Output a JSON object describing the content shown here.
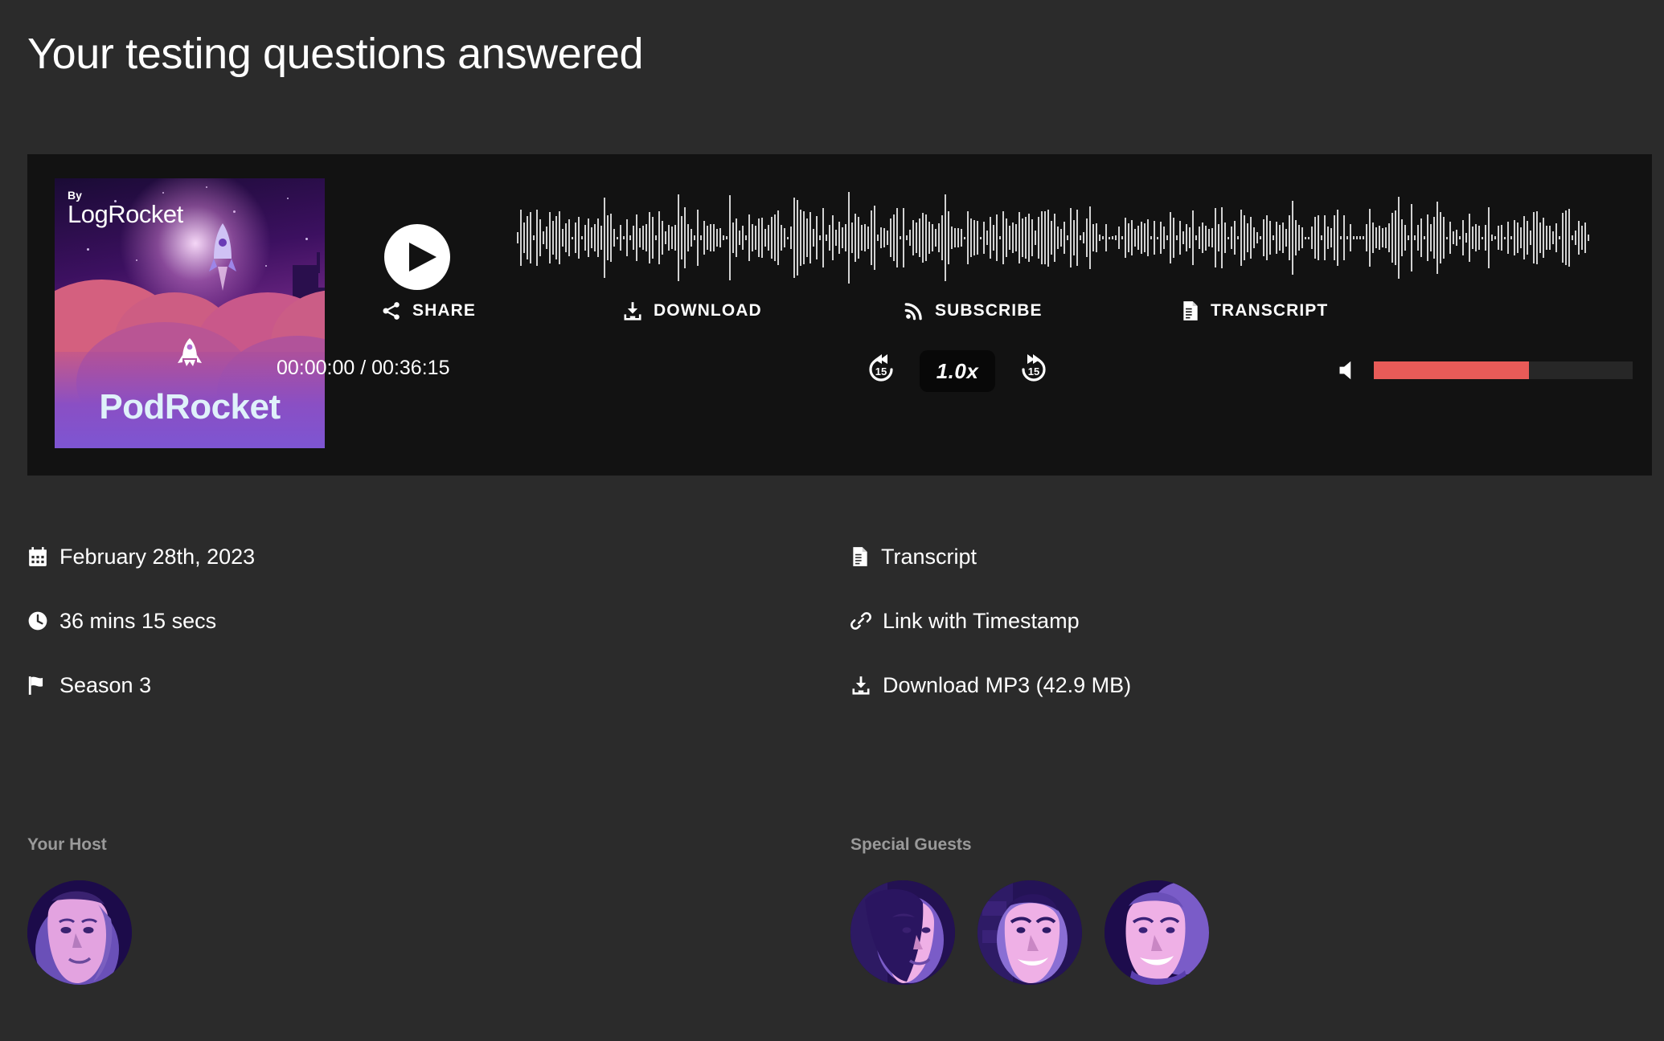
{
  "page": {
    "title": "Your testing questions answered",
    "background_color": "#2b2b2b"
  },
  "player": {
    "background_color": "#121212",
    "cover_art": {
      "byline_prefix": "By",
      "byline_brand": "LogRocket",
      "show_title": "PodRocket",
      "alt": "PodRocket podcast cover art by LogRocket"
    },
    "play_button_label": "Play",
    "waveform_label": "Audio waveform seek bar",
    "actions": [
      {
        "id": "share",
        "label": "SHARE",
        "icon": "share-icon"
      },
      {
        "id": "download",
        "label": "DOWNLOAD",
        "icon": "download-icon"
      },
      {
        "id": "subscribe",
        "label": "SUBSCRIBE",
        "icon": "rss-icon"
      },
      {
        "id": "transcript",
        "label": "TRANSCRIPT",
        "icon": "document-icon"
      }
    ],
    "transport": {
      "current_time": "00:00:00",
      "separator": " / ",
      "total_time": "00:36:15",
      "timecode": "00:00:00 / 00:36:15",
      "skip_back_label": "15",
      "skip_forward_label": "15",
      "speed": "1.0x",
      "volume": {
        "icon": "volume-icon",
        "level_percent": 60,
        "fill_color": "#e85b58",
        "track_color": "#272727"
      }
    }
  },
  "meta": {
    "left": [
      {
        "id": "date",
        "icon": "calendar-icon",
        "text": "February 28th, 2023",
        "link": false
      },
      {
        "id": "duration",
        "icon": "clock-icon",
        "text": "36 mins 15 secs",
        "link": false
      },
      {
        "id": "season",
        "icon": "flag-icon",
        "text": "Season 3",
        "link": false
      }
    ],
    "right": [
      {
        "id": "transcript",
        "icon": "document-icon",
        "text": "Transcript",
        "link": true
      },
      {
        "id": "timestamp-link",
        "icon": "link-icon",
        "text": "Link with Timestamp",
        "link": true
      },
      {
        "id": "download-mp3",
        "icon": "download-icon",
        "text": "Download MP3 (42.9 MB)",
        "link": true
      }
    ]
  },
  "people": {
    "host": {
      "heading": "Your Host",
      "avatars": [
        {
          "id": "host-1",
          "alt": "Host portrait"
        }
      ]
    },
    "guests": {
      "heading": "Special Guests",
      "avatars": [
        {
          "id": "guest-1",
          "alt": "Special guest portrait 1"
        },
        {
          "id": "guest-2",
          "alt": "Special guest portrait 2"
        },
        {
          "id": "guest-3",
          "alt": "Special guest portrait 3"
        }
      ]
    }
  }
}
